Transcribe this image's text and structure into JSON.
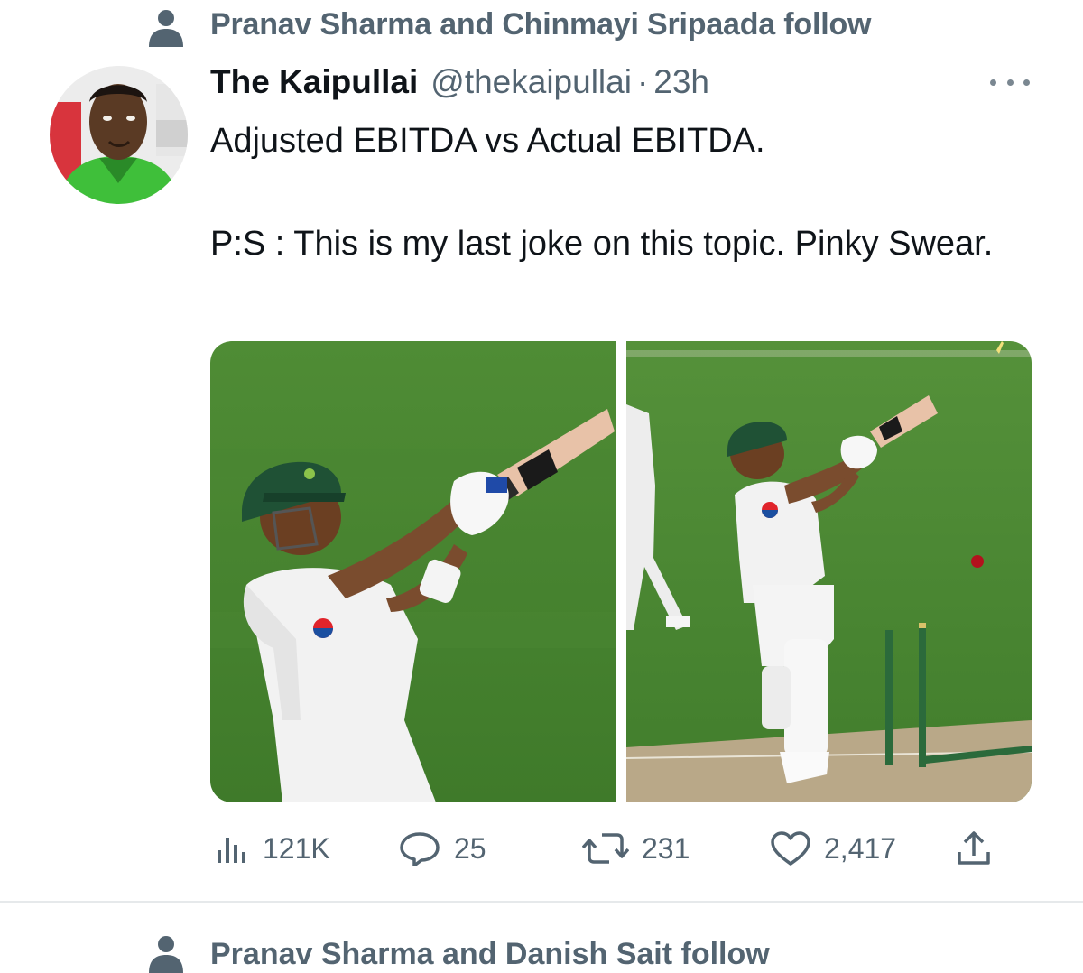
{
  "social_context": {
    "icon": "person-icon",
    "text": "Pranav Sharma and Chinmayi Sripaada follow"
  },
  "tweet": {
    "display_name": "The Kaipullai",
    "handle": "@thekaipullai",
    "separator": "·",
    "time": "23h",
    "text_line1": "Adjusted EBITDA vs Actual EBITDA.",
    "text_line2": "P:S : This is my last joke on this topic. Pinky Swear.",
    "media": [
      {
        "description": "cricket-batsman-swinging"
      },
      {
        "description": "cricket-batsman-bowled-stumps"
      }
    ]
  },
  "actions": {
    "views": {
      "icon": "views-icon",
      "count": "121K"
    },
    "replies": {
      "icon": "reply-icon",
      "count": "25"
    },
    "retweets": {
      "icon": "retweet-icon",
      "count": "231"
    },
    "likes": {
      "icon": "heart-icon",
      "count": "2,417"
    },
    "share": {
      "icon": "share-icon"
    }
  },
  "next_social_context": {
    "icon": "person-icon",
    "text": "Pranav Sharma and Danish Sait follow"
  },
  "colors": {
    "text": "#0f1419",
    "secondary": "#536471",
    "field_green": "#4d8a33",
    "kit_green": "#1f5135"
  }
}
